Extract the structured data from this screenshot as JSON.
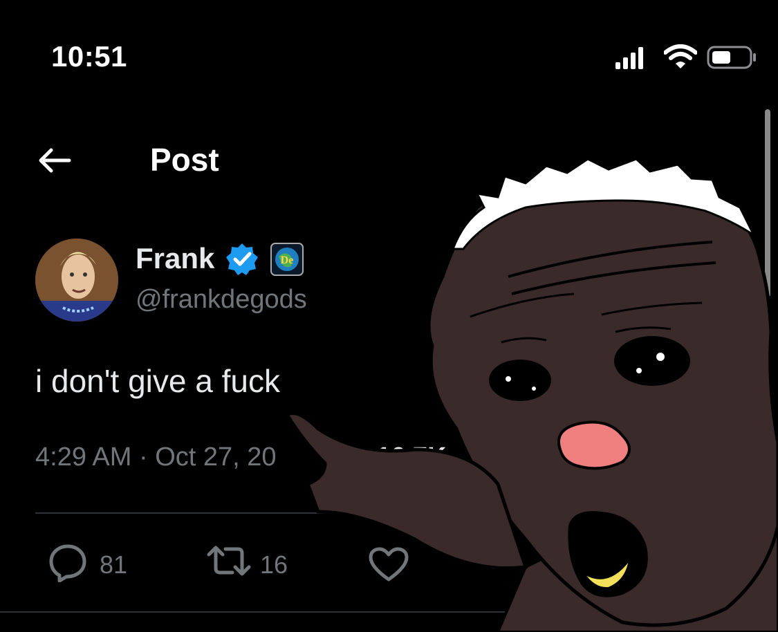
{
  "status_bar": {
    "time": "10:51",
    "signal_icon": "cellular-signal-icon",
    "wifi_icon": "wifi-icon",
    "battery_icon": "battery-icon"
  },
  "header": {
    "back_icon": "back-arrow-icon",
    "title": "Post"
  },
  "post": {
    "author": {
      "name": "Frank",
      "handle": "@frankdegods",
      "verified_icon": "verified-badge-icon",
      "org_badge_text": "De"
    },
    "text": "i don't give a fuck",
    "meta": {
      "time_date_visible": "4:29 AM · Oct 27, 20",
      "views_visible": "16.7K"
    },
    "actions": {
      "reply_count": "81",
      "repost_count": "16"
    }
  },
  "colors": {
    "background": "#000000",
    "text_primary": "#e7e9ea",
    "text_secondary": "#71767b",
    "verified_blue": "#1d9bf0",
    "divider": "#2f3336",
    "meme_skin": "#3b2a2a",
    "meme_hair": "#ffffff",
    "meme_nose": "#f08080",
    "meme_teeth": "#f2e05a"
  }
}
